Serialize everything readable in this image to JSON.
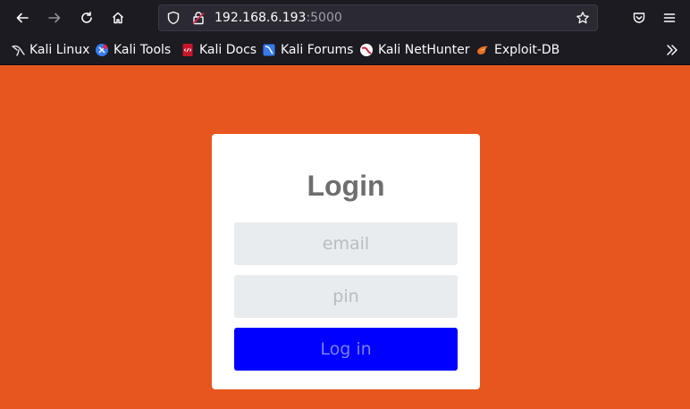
{
  "browser": {
    "url_host": "192.168.6.193",
    "url_port": ":5000",
    "bookmarks": [
      {
        "label": "Kali Linux",
        "icon": "kali-dragon-icon"
      },
      {
        "label": "Kali Tools",
        "icon": "kali-tools-icon"
      },
      {
        "label": "Kali Docs",
        "icon": "kali-docs-icon"
      },
      {
        "label": "Kali Forums",
        "icon": "kali-forums-icon"
      },
      {
        "label": "Kali NetHunter",
        "icon": "kali-nethunter-icon"
      },
      {
        "label": "Exploit-DB",
        "icon": "exploit-db-icon"
      }
    ]
  },
  "login": {
    "title": "Login",
    "email_placeholder": "email",
    "pin_placeholder": "pin",
    "button_label": "Log in"
  },
  "colors": {
    "page_background": "#e8561f",
    "button_background": "#0000ff",
    "input_background": "#e9ecee"
  }
}
